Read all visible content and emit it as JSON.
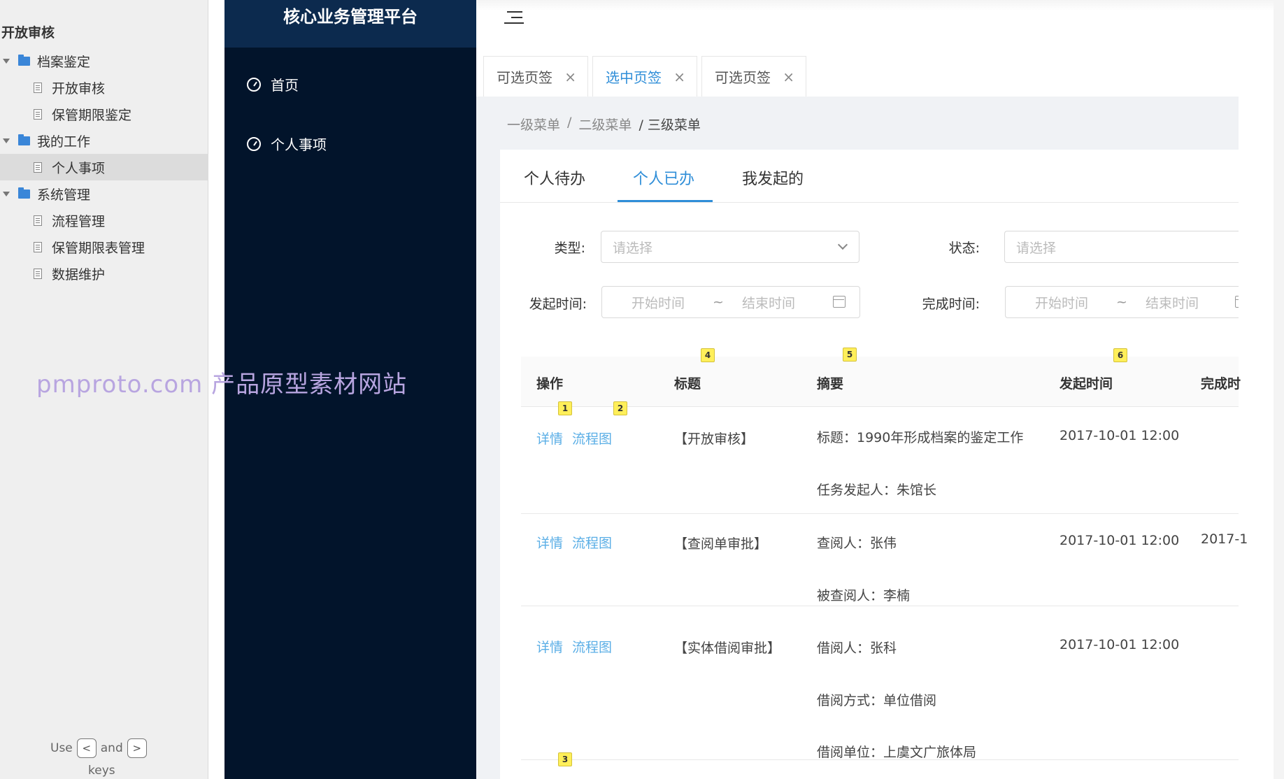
{
  "sitemap": {
    "page_name": "开放审核",
    "items": [
      {
        "label": "档案鉴定",
        "type": "folder"
      },
      {
        "label": "开放审核",
        "type": "page"
      },
      {
        "label": "保管期限鉴定",
        "type": "page"
      },
      {
        "label": "我的工作",
        "type": "folder"
      },
      {
        "label": "个人事项",
        "type": "page",
        "active": true
      },
      {
        "label": "系统管理",
        "type": "folder"
      },
      {
        "label": "流程管理",
        "type": "page"
      },
      {
        "label": "保管期限表管理",
        "type": "page"
      },
      {
        "label": "数据维护",
        "type": "page"
      }
    ],
    "hint_use": "Use",
    "hint_and": "and",
    "hint_keys": "keys",
    "key_prev": "<",
    "key_next": ">"
  },
  "watermark": "pmproto.com 产品原型素材网站",
  "app": {
    "title": "核心业务管理平台",
    "nav": [
      {
        "label": "首页"
      },
      {
        "label": "个人事项"
      }
    ]
  },
  "page_tabs": [
    {
      "label": "可选页签",
      "close": "×"
    },
    {
      "label": "选中页签",
      "close": "×"
    },
    {
      "label": "可选页签",
      "close": "×"
    }
  ],
  "breadcrumb": [
    "一级菜单",
    "/",
    "二级菜单",
    "/ 三级菜单"
  ],
  "sub_tabs": [
    "个人待办",
    "个人已办",
    "我发起的"
  ],
  "filters": {
    "type_label": "类型:",
    "type_placeholder": "请选择",
    "status_label": "状态:",
    "status_placeholder": "请选择",
    "start_label": "发起时间:",
    "finish_label": "完成时间:",
    "range_start": "开始时间",
    "range_sep": "~",
    "range_end": "结束时间"
  },
  "table": {
    "headers": [
      "操作",
      "标题",
      "摘要",
      "发起时间",
      "完成时"
    ],
    "rows": [
      {
        "actions": [
          "详情",
          "流程图"
        ],
        "title": "【开放审核】",
        "summary": [
          "标题：1990年形成档案的鉴定工作",
          "任务发起人：朱馆长"
        ],
        "start": "2017-10-01 12:00",
        "finish": ""
      },
      {
        "actions": [
          "详情",
          "流程图"
        ],
        "title": "【查阅单审批】",
        "summary": [
          "查阅人：张伟",
          "被查阅人：李楠"
        ],
        "start": "2017-10-01 12:00",
        "finish": "2017-1"
      },
      {
        "actions": [
          "详情",
          "流程图"
        ],
        "title": "【实体借阅审批】",
        "summary": [
          "借阅人：张科",
          "借阅方式：单位借阅",
          "借阅单位：上虞文广旅体局"
        ],
        "start": "2017-10-01 12:00",
        "finish": ""
      }
    ]
  },
  "markers": [
    "1",
    "2",
    "3",
    "4",
    "5",
    "6"
  ],
  "icons": {
    "folder": "folder-icon",
    "page": "page-icon",
    "nav": "gauge-icon",
    "toggle": "menu-fold-icon",
    "close": "close-icon",
    "dropdown": "chevron-down-icon",
    "calendar": "calendar-icon"
  },
  "colors": {
    "accent": "#2f8ed8",
    "link": "#5aaee6",
    "sidebar_bg": "#02142b",
    "logo_bg": "#0c2a4e",
    "marker": "#ffef5a",
    "watermark": "#b8a5e0"
  }
}
